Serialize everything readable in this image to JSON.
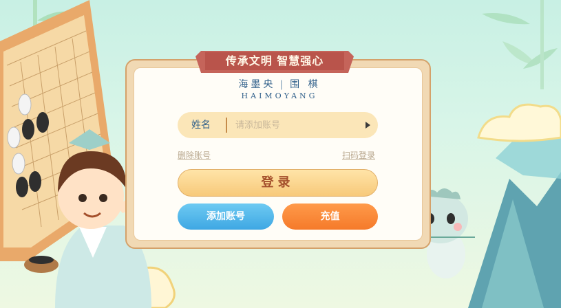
{
  "banner": {
    "slogan": "传承文明 智慧强心"
  },
  "brand": {
    "cn_main": "海墨央",
    "cn_sub": "围 棋",
    "en": "HAIMOYANG"
  },
  "login_form": {
    "name_label": "姓名",
    "name_placeholder": "请添加账号",
    "delete_account_link": "删除账号",
    "scan_login_link": "扫码登录",
    "login_button": "登录",
    "add_account_button": "添加账号",
    "recharge_button": "充值"
  },
  "colors": {
    "brand_blue": "#2f5f8a",
    "login_text": "#a4502c",
    "add_blue": "#3ea7e3",
    "recharge_orange": "#f57a2a",
    "banner_red": "#c5645a"
  },
  "icons": [
    "go-board-illustration",
    "scholar-character",
    "dragon-mascot",
    "mountain-illustration",
    "cloud-decoration",
    "bamboo-decoration",
    "dropdown-arrow-icon"
  ]
}
